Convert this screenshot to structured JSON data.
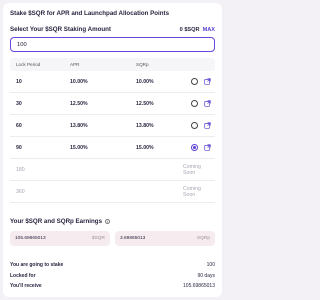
{
  "header": {
    "title": "Stake $SQR for APR and Launchpad Allocation Points"
  },
  "amount": {
    "label": "Select Your $SQR Staking Amount",
    "balance": "0 $SQR",
    "max_label": "MAX",
    "value": "100"
  },
  "table": {
    "headers": {
      "period": "Lock Period",
      "apr": "APR",
      "sqrp": "SQRp"
    },
    "rows": [
      {
        "period": "10",
        "apr": "10.00%",
        "sqrp": "10.00%",
        "selected": false,
        "available": true
      },
      {
        "period": "30",
        "apr": "12.50%",
        "sqrp": "12.50%",
        "selected": false,
        "available": true
      },
      {
        "period": "60",
        "apr": "13.80%",
        "sqrp": "13.80%",
        "selected": false,
        "available": true
      },
      {
        "period": "90",
        "apr": "15.00%",
        "sqrp": "15.00%",
        "selected": true,
        "available": true
      },
      {
        "period": "180",
        "status": "Coming Soon",
        "available": false
      },
      {
        "period": "360",
        "status": "Coming Soon",
        "available": false
      }
    ]
  },
  "earnings": {
    "title": "Your $SQR and SQRp Earnings",
    "sqr_value": "105.69865013",
    "sqr_unit": "$SQR",
    "sqrp_value": "3.69865013",
    "sqrp_unit": "SQRp"
  },
  "summary": {
    "stake_label": "You are going to stake",
    "stake_value": "100",
    "locked_label": "Locked for",
    "locked_value": "90 days",
    "receive_label": "You'll receive",
    "receive_value": "105.69865013"
  },
  "colors": {
    "accent": "#5b3fd0",
    "earn_bg": "#f6ecef"
  },
  "icons": {
    "radio": "radio-icon",
    "external": "external-link-icon",
    "info": "info-icon"
  }
}
